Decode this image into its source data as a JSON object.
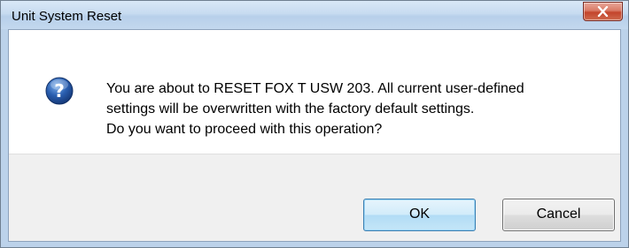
{
  "dialog": {
    "title": "Unit System Reset",
    "icon": "question-icon",
    "message_lines": [
      "You are about to RESET FOX T USW 203. All current user-defined",
      "settings will be overwritten with the factory default settings.",
      "Do you want to proceed with this operation?"
    ],
    "buttons": {
      "ok_label": "OK",
      "cancel_label": "Cancel"
    }
  },
  "colors": {
    "close_button": "#c3442b",
    "question_icon": "#2a5fb0",
    "ok_border": "#3c7fb1"
  }
}
